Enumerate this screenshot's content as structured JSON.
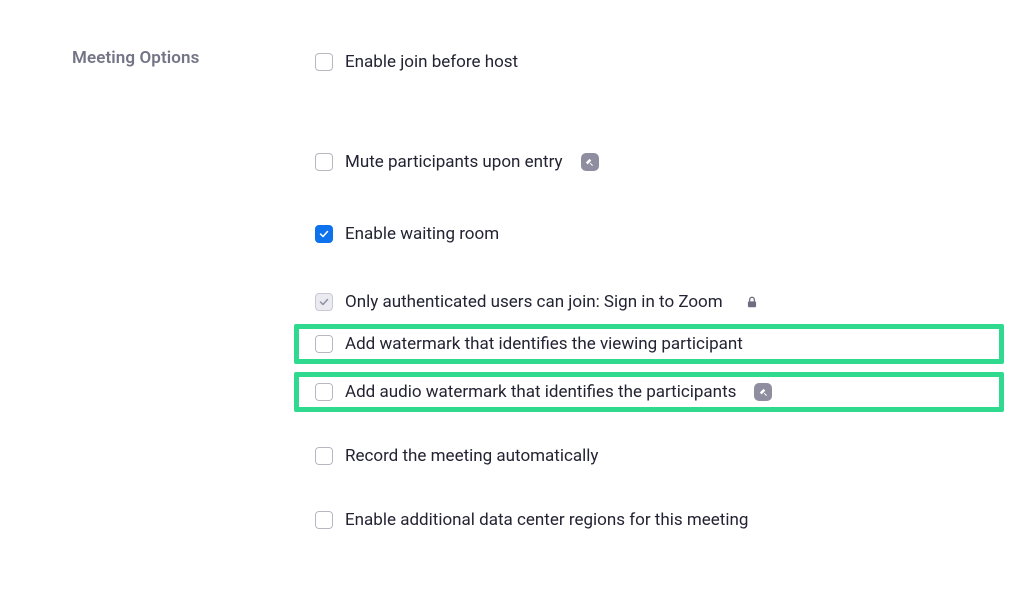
{
  "section": {
    "title": "Meeting Options"
  },
  "options": {
    "join_before_host": {
      "label": "Enable join before host"
    },
    "mute_on_entry": {
      "label": "Mute participants upon entry"
    },
    "waiting_room": {
      "label": "Enable waiting room"
    },
    "auth_only": {
      "label": "Only authenticated users can join: Sign in to Zoom"
    },
    "watermark_video": {
      "label": "Add watermark that identifies the viewing participant"
    },
    "watermark_audio": {
      "label": "Add audio watermark that identifies the participants"
    },
    "auto_record": {
      "label": "Record the meeting automatically"
    },
    "dc_regions": {
      "label": "Enable additional data center regions for this meeting"
    }
  }
}
